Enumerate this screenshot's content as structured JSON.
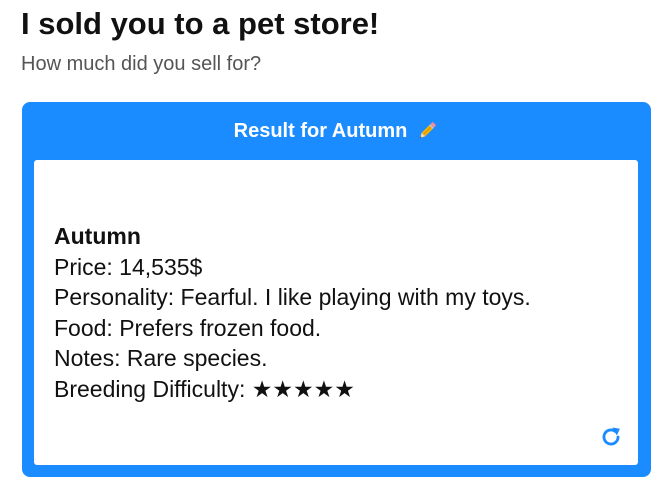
{
  "page": {
    "title": "I sold you to a pet store!",
    "subtitle": "How much did you sell for?"
  },
  "card": {
    "header_label": "Result for Autumn",
    "header_icon": "pencil-icon",
    "accent_color": "#1b8cff"
  },
  "result": {
    "name": "Autumn",
    "price": "Price: 14,535$",
    "personality": "Personality: Fearful. I like playing with my toys.",
    "food": "Food: Prefers frozen food.",
    "notes": "Notes: Rare species.",
    "breeding": "Breeding Difficulty: ★★★★★"
  },
  "actions": {
    "refresh_icon": "refresh-icon"
  }
}
